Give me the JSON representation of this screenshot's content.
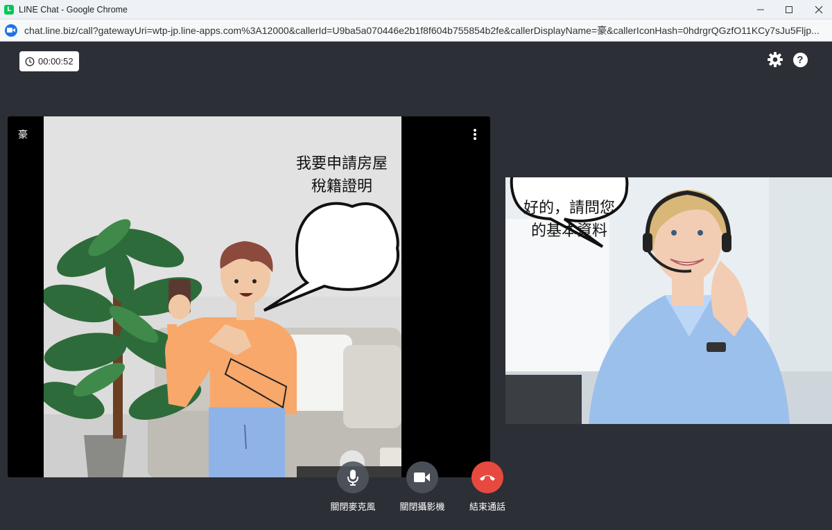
{
  "window": {
    "title": "LINE Chat - Google Chrome",
    "url": "chat.line.biz/call?gatewayUri=wtp-jp.line-apps.com%3A12000&callerId=U9ba5a070446e2b1f8f604b755854b2fe&callerDisplayName=豪&callerIconHash=0hdrgrQGzfO11KCy7sJu5Fljp..."
  },
  "call": {
    "timer": "00:00:52",
    "caller_name": "豪",
    "caller_speech": "我要申請房屋稅籍證明",
    "agent_speech": "好的，請問您的基本資料"
  },
  "controls": {
    "mic_label": "關閉麥克風",
    "camera_label": "關閉攝影機",
    "end_label": "結束通話"
  },
  "colors": {
    "background": "#2c2f36",
    "end_call": "#e8493f",
    "line_green": "#06c755",
    "chrome_blue": "#1a73e8"
  },
  "icons": [
    "line-app-icon",
    "video-camera-site-icon",
    "clock-icon",
    "gear-icon",
    "help-icon",
    "more-vertical-icon",
    "microphone-icon",
    "video-camera-icon",
    "phone-hangup-icon"
  ]
}
